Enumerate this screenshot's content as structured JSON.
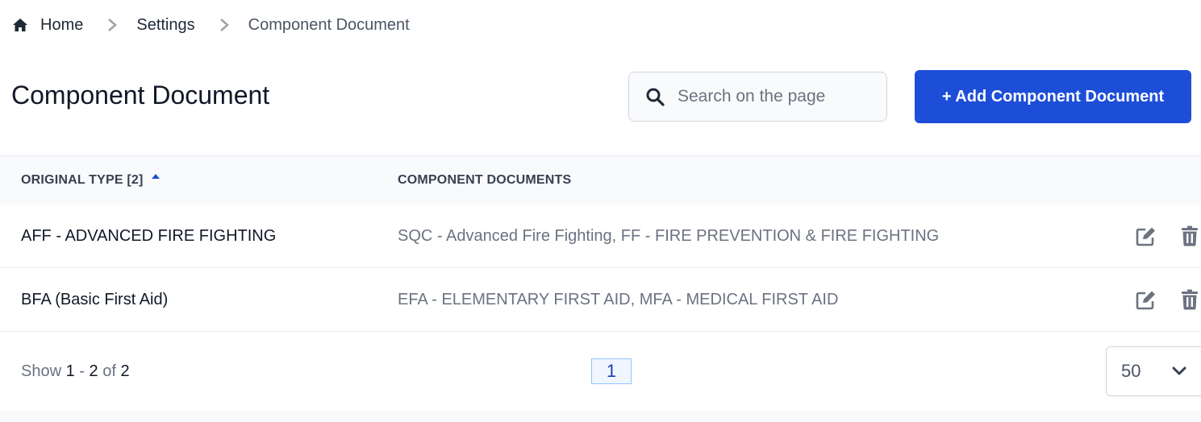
{
  "breadcrumb": {
    "items": [
      {
        "label": "Home",
        "icon": "home-icon"
      },
      {
        "label": "Settings"
      },
      {
        "label": "Component Document"
      }
    ],
    "separator_icon": "chevron-right-icon"
  },
  "header": {
    "title": "Component Document",
    "search": {
      "placeholder": "Search on the page",
      "value": "",
      "icon": "search-icon"
    },
    "add_button_label": "+ Add Component Document"
  },
  "table": {
    "columns": [
      {
        "label": "ORIGINAL TYPE [2]",
        "sort": "ascending"
      },
      {
        "label": "COMPONENT DOCUMENTS"
      }
    ],
    "rows": [
      {
        "original_type": "AFF - ADVANCED FIRE FIGHTING",
        "component_documents": "SQC - Advanced Fire Fighting, FF - FIRE PREVENTION & FIRE FIGHTING"
      },
      {
        "original_type": "BFA (Basic First Aid)",
        "component_documents": "EFA - ELEMENTARY FIRST AID, MFA - MEDICAL FIRST AID"
      }
    ],
    "row_actions": [
      "edit-icon",
      "delete-icon"
    ]
  },
  "pagination": {
    "show_label": "Show",
    "from": "1",
    "dash": "-",
    "to": "2",
    "of_label": "of",
    "total": "2",
    "current_page": "1",
    "page_size": "50"
  },
  "colors": {
    "accent": "#1d4ed8",
    "sort_arrow": "#1d4ed8",
    "page_active_bg": "#eff6ff"
  }
}
